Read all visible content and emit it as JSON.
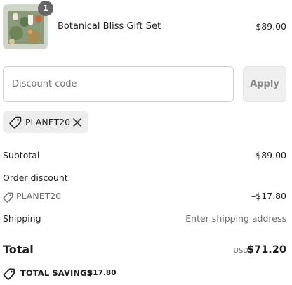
{
  "product": {
    "quantity": "1",
    "name": "Botanical Bliss Gift Set",
    "price": "$89.00"
  },
  "discount": {
    "placeholder": "Discount code",
    "apply_label": "Apply",
    "applied_code": "PLANET20"
  },
  "summary": {
    "subtotal_label": "Subtotal",
    "subtotal_value": "$89.00",
    "order_discount_label": "Order discount",
    "discount_code": "PLANET20",
    "discount_value": "–$17.80",
    "shipping_label": "Shipping",
    "shipping_value": "Enter shipping address"
  },
  "total": {
    "label": "Total",
    "currency": "USD",
    "value": "$71.20"
  },
  "savings": {
    "label": "TOTAL SAVINGS",
    "value": "$17.80"
  },
  "colors": {
    "badge": "#666666",
    "chip_bg": "#ededed",
    "apply_bg": "#f0f0f0",
    "muted_text": "#6b6b6b"
  },
  "icons": [
    "tag-icon",
    "close-icon",
    "product-thumbnail"
  ]
}
